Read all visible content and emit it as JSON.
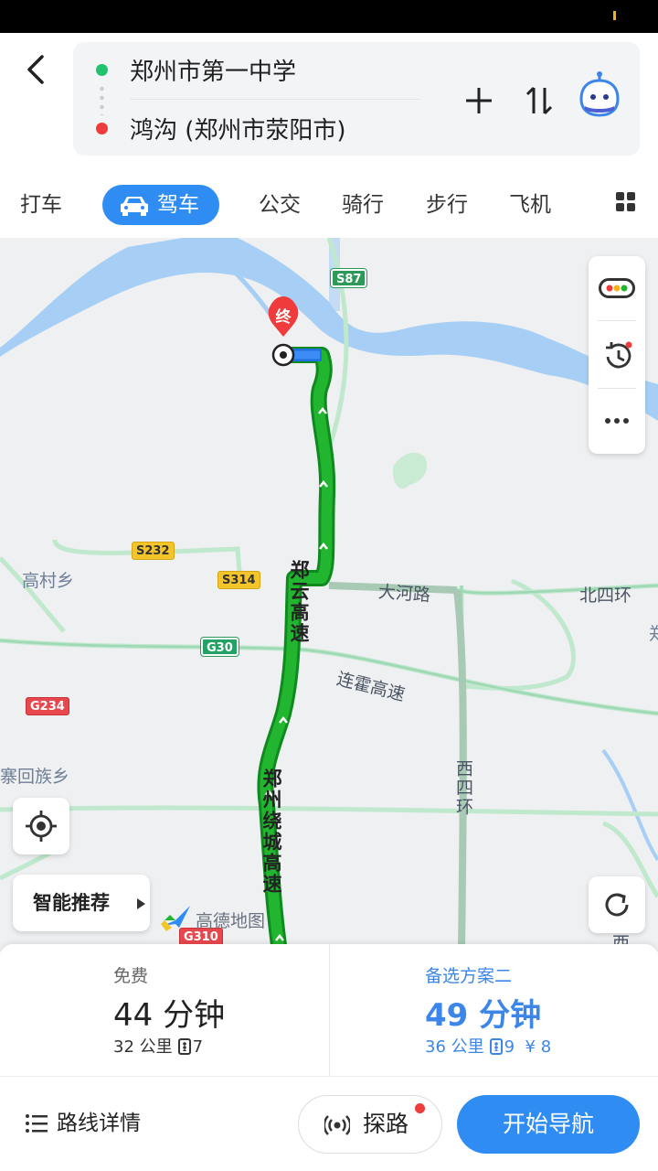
{
  "route": {
    "start": "郑州市第一中学",
    "end": "鸿沟 (郑州市荥阳市)"
  },
  "modes": {
    "taxi": "打车",
    "drive": "驾车",
    "bus": "公交",
    "ride": "骑行",
    "walk": "步行",
    "flight": "飞机"
  },
  "map": {
    "end_marker": "终",
    "shields": {
      "s87": "S87",
      "s232": "S232",
      "s314": "S314",
      "g30": "G30",
      "g234": "G234",
      "g310": "G310"
    },
    "places": {
      "gaocun": "高村乡",
      "hui": "寨回族乡",
      "beisihuan": "北四环",
      "edge": "郑"
    },
    "roads": {
      "dahe": "大河路",
      "lianhuo": "连霍高速",
      "zhengyun": "郑云高速",
      "raocheng": "郑州绕城高速",
      "xisihuan": "西四环",
      "edge_right": "西"
    },
    "smart_recommend": "智能推荐",
    "logo_text": "高德地图"
  },
  "plans": [
    {
      "tag": "免费",
      "time": "44 分钟",
      "distance": "32 公里",
      "lights": "7",
      "cost": ""
    },
    {
      "tag": "备选方案二",
      "time": "49 分钟",
      "distance": "36 公里",
      "lights": "9",
      "cost": "¥ 8"
    }
  ],
  "actions": {
    "route_detail": "路线详情",
    "probe": "探路",
    "start_nav": "开始导航"
  },
  "colors": {
    "accent": "#2f8cf3",
    "route": "#1fae2f",
    "start_dot": "#21c36f",
    "end_dot": "#ef3b3b"
  }
}
